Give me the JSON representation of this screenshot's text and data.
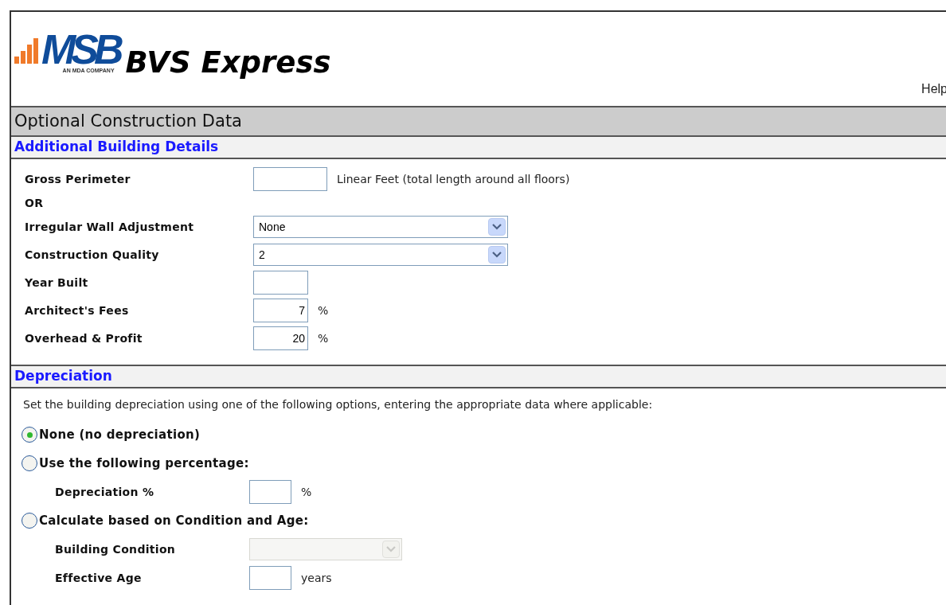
{
  "header": {
    "logo_mark": "MSB",
    "logo_tagline": "AN MDA COMPANY",
    "app_name": "BVS Express",
    "help_link": "Help"
  },
  "page_title": "Optional Construction Data",
  "details": {
    "title": "Additional Building Details",
    "rows": [
      {
        "kind": "text",
        "label": "Gross Perimeter",
        "suffix": "Linear Feet (total length around all floors)"
      },
      {
        "kind": "note",
        "label": "OR"
      },
      {
        "kind": "select",
        "label": "Irregular Wall Adjustment",
        "value": "None",
        "disabled": false
      },
      {
        "kind": "select",
        "label": "Construction Quality",
        "value": "2",
        "disabled": false
      },
      {
        "kind": "number",
        "label": "Year Built"
      },
      {
        "kind": "number",
        "label": "Architect's Fees",
        "value": "7",
        "suffix": "%"
      },
      {
        "kind": "number",
        "label": "Overhead & Profit",
        "value": "20",
        "suffix": "%"
      }
    ]
  },
  "depreciation": {
    "title": "Depreciation",
    "intro": "Set the building depreciation using one of the following options, entering the appropriate data where applicable:",
    "options": [
      {
        "label": "None (no depreciation)",
        "selected": true
      },
      {
        "label": "Use the following percentage:",
        "selected": false,
        "fields": [
          {
            "kind": "small",
            "label": "Depreciation %",
            "suffix": "%"
          }
        ]
      },
      {
        "label": "Calculate based on Condition and Age:",
        "selected": false,
        "fields": [
          {
            "kind": "select",
            "label": "Building Condition",
            "disabled": true
          },
          {
            "kind": "small",
            "label": "Effective Age",
            "suffix": "years"
          }
        ]
      }
    ]
  }
}
